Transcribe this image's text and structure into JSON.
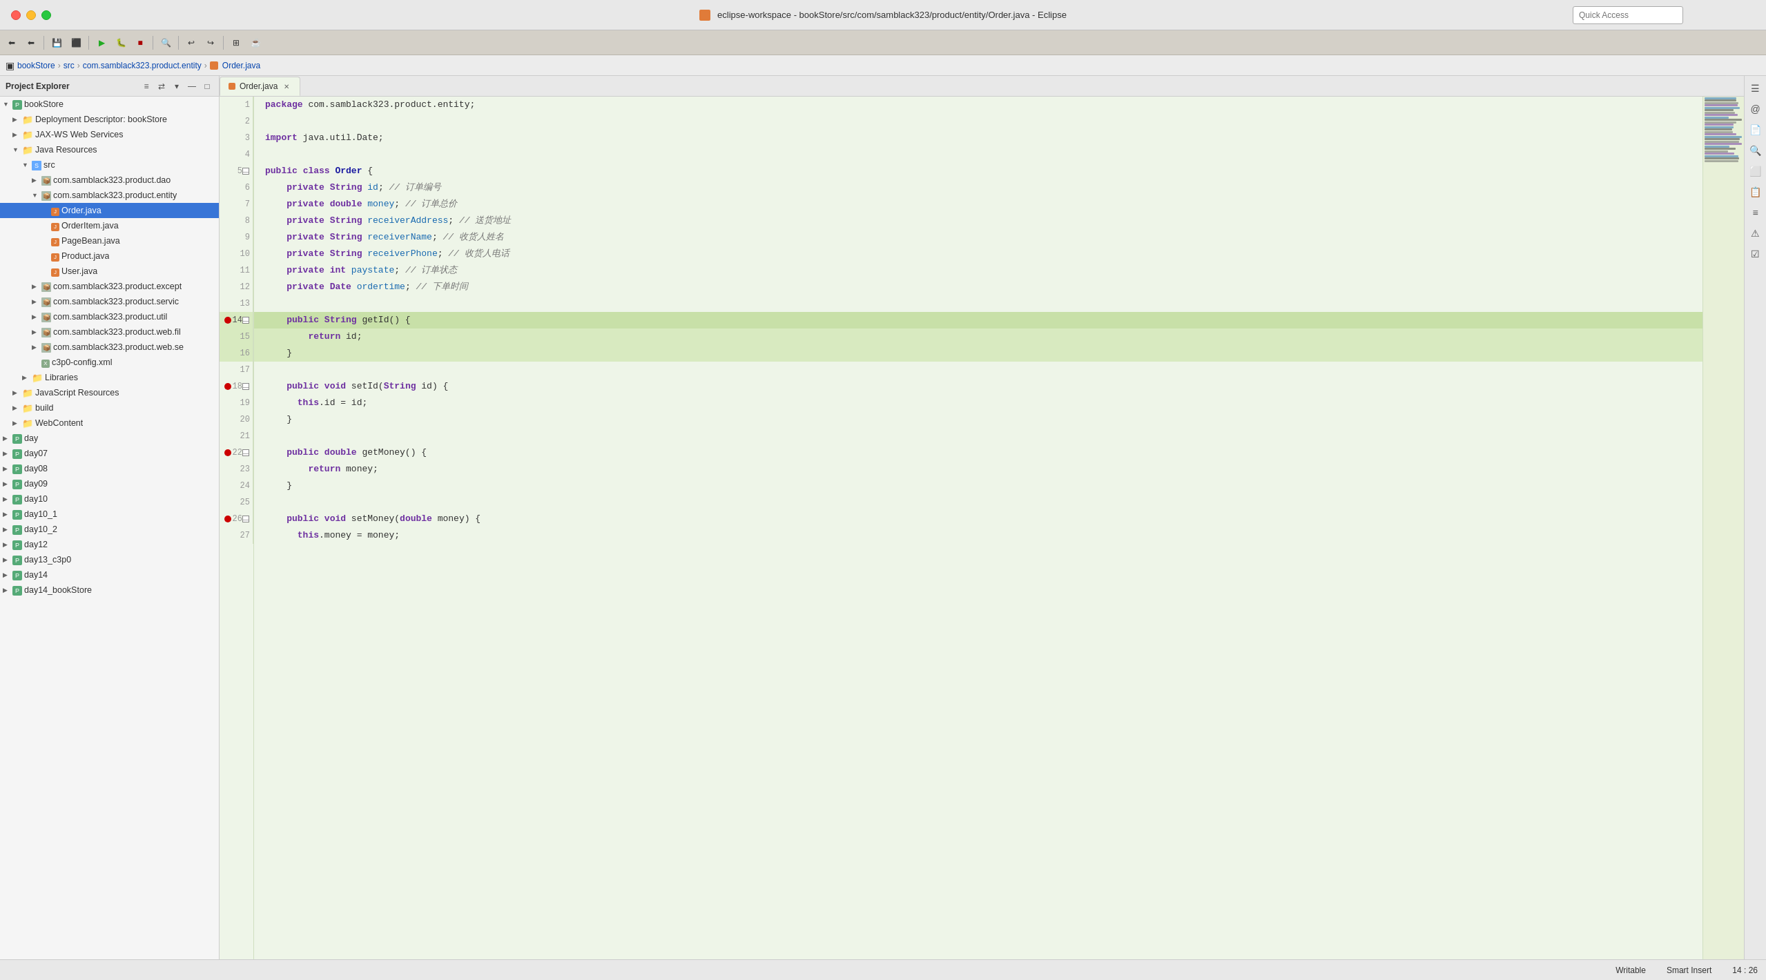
{
  "window": {
    "title": "eclipse-workspace - bookStore/src/com/samblack323/product/entity/Order.java - Eclipse",
    "quick_access_placeholder": "Quick Access"
  },
  "breadcrumb": {
    "items": [
      "bookStore",
      "src",
      "com.samblack323.product.entity",
      "Order.java"
    ]
  },
  "sidebar": {
    "title": "Project Explorer",
    "tree": [
      {
        "id": "bookStore",
        "label": "bookStore",
        "level": 0,
        "type": "project",
        "open": true
      },
      {
        "id": "deployment",
        "label": "Deployment Descriptor: bookStore",
        "level": 1,
        "type": "folder",
        "open": false
      },
      {
        "id": "jaxws",
        "label": "JAX-WS Web Services",
        "level": 1,
        "type": "folder",
        "open": false
      },
      {
        "id": "java-resources",
        "label": "Java Resources",
        "level": 1,
        "type": "folder",
        "open": true
      },
      {
        "id": "src",
        "label": "src",
        "level": 2,
        "type": "src-folder",
        "open": true
      },
      {
        "id": "pkg-dao",
        "label": "com.samblack323.product.dao",
        "level": 3,
        "type": "package",
        "open": false
      },
      {
        "id": "pkg-entity",
        "label": "com.samblack323.product.entity",
        "level": 3,
        "type": "package",
        "open": true
      },
      {
        "id": "Order.java",
        "label": "Order.java",
        "level": 4,
        "type": "java",
        "selected": true
      },
      {
        "id": "OrderItem.java",
        "label": "OrderItem.java",
        "level": 4,
        "type": "java"
      },
      {
        "id": "PageBean.java",
        "label": "PageBean.java",
        "level": 4,
        "type": "java"
      },
      {
        "id": "Product.java",
        "label": "Product.java",
        "level": 4,
        "type": "java"
      },
      {
        "id": "User.java",
        "label": "User.java",
        "level": 4,
        "type": "java"
      },
      {
        "id": "pkg-except",
        "label": "com.samblack323.product.except",
        "level": 3,
        "type": "package",
        "open": false
      },
      {
        "id": "pkg-service",
        "label": "com.samblack323.product.servic",
        "level": 3,
        "type": "package",
        "open": false
      },
      {
        "id": "pkg-util",
        "label": "com.samblack323.product.util",
        "level": 3,
        "type": "package",
        "open": false
      },
      {
        "id": "pkg-web-fil",
        "label": "com.samblack323.product.web.fil",
        "level": 3,
        "type": "package",
        "open": false
      },
      {
        "id": "pkg-web-se",
        "label": "com.samblack323.product.web.se",
        "level": 3,
        "type": "package",
        "open": false
      },
      {
        "id": "c3p0-config",
        "label": "c3p0-config.xml",
        "level": 3,
        "type": "xml"
      },
      {
        "id": "libraries",
        "label": "Libraries",
        "level": 2,
        "type": "folder",
        "open": false
      },
      {
        "id": "js-resources",
        "label": "JavaScript Resources",
        "level": 1,
        "type": "folder",
        "open": false
      },
      {
        "id": "build",
        "label": "build",
        "level": 1,
        "type": "folder",
        "open": false
      },
      {
        "id": "WebContent",
        "label": "WebContent",
        "level": 1,
        "type": "folder",
        "open": false
      },
      {
        "id": "day",
        "label": "day",
        "level": 0,
        "type": "project"
      },
      {
        "id": "day07",
        "label": "day07",
        "level": 0,
        "type": "project"
      },
      {
        "id": "day08",
        "label": "day08",
        "level": 0,
        "type": "project"
      },
      {
        "id": "day09",
        "label": "day09",
        "level": 0,
        "type": "project"
      },
      {
        "id": "day10",
        "label": "day10",
        "level": 0,
        "type": "project"
      },
      {
        "id": "day10_1",
        "label": "day10_1",
        "level": 0,
        "type": "project"
      },
      {
        "id": "day10_2",
        "label": "day10_2",
        "level": 0,
        "type": "project"
      },
      {
        "id": "day12",
        "label": "day12",
        "level": 0,
        "type": "project"
      },
      {
        "id": "day13_c3p0",
        "label": "day13_c3p0",
        "level": 0,
        "type": "project"
      },
      {
        "id": "day14",
        "label": "day14",
        "level": 0,
        "type": "project"
      },
      {
        "id": "day14_bookStore",
        "label": "day14_bookStore",
        "level": 0,
        "type": "project"
      }
    ]
  },
  "editor": {
    "tab": "Order.java",
    "lines": [
      {
        "num": 1,
        "tokens": [
          {
            "t": "package",
            "c": "kw"
          },
          {
            "t": " com.samblack323.product.entity;",
            "c": ""
          }
        ]
      },
      {
        "num": 2,
        "tokens": []
      },
      {
        "num": 3,
        "tokens": [
          {
            "t": "import",
            "c": "kw"
          },
          {
            "t": " java.util.Date;",
            "c": ""
          }
        ]
      },
      {
        "num": 4,
        "tokens": []
      },
      {
        "num": 5,
        "tokens": [
          {
            "t": "public",
            "c": "kw"
          },
          {
            "t": " ",
            "c": ""
          },
          {
            "t": "class",
            "c": "kw"
          },
          {
            "t": " ",
            "c": ""
          },
          {
            "t": "Order",
            "c": "cls"
          },
          {
            "t": " {",
            "c": ""
          }
        ]
      },
      {
        "num": 6,
        "tokens": [
          {
            "t": "    ",
            "c": ""
          },
          {
            "t": "private",
            "c": "kw"
          },
          {
            "t": " ",
            "c": ""
          },
          {
            "t": "String",
            "c": "type"
          },
          {
            "t": " ",
            "c": ""
          },
          {
            "t": "id",
            "c": "field"
          },
          {
            "t": "; ",
            "c": ""
          },
          {
            "t": "// 订单编号",
            "c": "comment"
          }
        ]
      },
      {
        "num": 7,
        "tokens": [
          {
            "t": "    ",
            "c": ""
          },
          {
            "t": "private",
            "c": "kw"
          },
          {
            "t": " ",
            "c": ""
          },
          {
            "t": "double",
            "c": "type"
          },
          {
            "t": " ",
            "c": ""
          },
          {
            "t": "money",
            "c": "field"
          },
          {
            "t": "; ",
            "c": ""
          },
          {
            "t": "// 订单总价",
            "c": "comment"
          }
        ]
      },
      {
        "num": 8,
        "tokens": [
          {
            "t": "    ",
            "c": ""
          },
          {
            "t": "private",
            "c": "kw"
          },
          {
            "t": " ",
            "c": ""
          },
          {
            "t": "String",
            "c": "type"
          },
          {
            "t": " ",
            "c": ""
          },
          {
            "t": "receiverAddress",
            "c": "field"
          },
          {
            "t": "; ",
            "c": ""
          },
          {
            "t": "// 送货地址",
            "c": "comment"
          }
        ]
      },
      {
        "num": 9,
        "tokens": [
          {
            "t": "    ",
            "c": ""
          },
          {
            "t": "private",
            "c": "kw"
          },
          {
            "t": " ",
            "c": ""
          },
          {
            "t": "String",
            "c": "type"
          },
          {
            "t": " ",
            "c": ""
          },
          {
            "t": "receiverName",
            "c": "field"
          },
          {
            "t": "; ",
            "c": ""
          },
          {
            "t": "// 收货人姓名",
            "c": "comment"
          }
        ]
      },
      {
        "num": 10,
        "tokens": [
          {
            "t": "    ",
            "c": ""
          },
          {
            "t": "private",
            "c": "kw"
          },
          {
            "t": " ",
            "c": ""
          },
          {
            "t": "String",
            "c": "type"
          },
          {
            "t": " ",
            "c": ""
          },
          {
            "t": "receiverPhone",
            "c": "field"
          },
          {
            "t": "; ",
            "c": ""
          },
          {
            "t": "// 收货人电话",
            "c": "comment"
          }
        ]
      },
      {
        "num": 11,
        "tokens": [
          {
            "t": "    ",
            "c": ""
          },
          {
            "t": "private",
            "c": "kw"
          },
          {
            "t": " ",
            "c": ""
          },
          {
            "t": "int",
            "c": "type"
          },
          {
            "t": " ",
            "c": ""
          },
          {
            "t": "paystate",
            "c": "field"
          },
          {
            "t": "; ",
            "c": ""
          },
          {
            "t": "// 订单状态",
            "c": "comment"
          }
        ]
      },
      {
        "num": 12,
        "tokens": [
          {
            "t": "    ",
            "c": ""
          },
          {
            "t": "private",
            "c": "kw"
          },
          {
            "t": " ",
            "c": ""
          },
          {
            "t": "Date",
            "c": "type"
          },
          {
            "t": " ",
            "c": ""
          },
          {
            "t": "ordertime",
            "c": "field"
          },
          {
            "t": "; ",
            "c": ""
          },
          {
            "t": "// 下单时间",
            "c": "comment"
          }
        ]
      },
      {
        "num": 13,
        "tokens": []
      },
      {
        "num": 14,
        "tokens": [
          {
            "t": "    ",
            "c": ""
          },
          {
            "t": "public",
            "c": "kw"
          },
          {
            "t": " ",
            "c": ""
          },
          {
            "t": "String",
            "c": "type"
          },
          {
            "t": " getId() {",
            "c": ""
          }
        ],
        "highlighted": true,
        "breakpoint": true
      },
      {
        "num": 15,
        "tokens": [
          {
            "t": "        ",
            "c": ""
          },
          {
            "t": "return",
            "c": "kw"
          },
          {
            "t": " id;",
            "c": ""
          }
        ],
        "highlighted": true
      },
      {
        "num": 16,
        "tokens": [
          {
            "t": "    }",
            "c": ""
          }
        ],
        "highlighted": true
      },
      {
        "num": 17,
        "tokens": []
      },
      {
        "num": 18,
        "tokens": [
          {
            "t": "    ",
            "c": ""
          },
          {
            "t": "public",
            "c": "kw"
          },
          {
            "t": " ",
            "c": ""
          },
          {
            "t": "void",
            "c": "type"
          },
          {
            "t": " setId(",
            "c": ""
          },
          {
            "t": "String",
            "c": "type"
          },
          {
            "t": " id) {",
            "c": ""
          }
        ],
        "breakpoint": true
      },
      {
        "num": 19,
        "tokens": [
          {
            "t": "      ",
            "c": ""
          },
          {
            "t": "this",
            "c": "kw"
          },
          {
            "t": ".id = id;",
            "c": ""
          }
        ]
      },
      {
        "num": 20,
        "tokens": [
          {
            "t": "    }",
            "c": ""
          }
        ]
      },
      {
        "num": 21,
        "tokens": []
      },
      {
        "num": 22,
        "tokens": [
          {
            "t": "    ",
            "c": ""
          },
          {
            "t": "public",
            "c": "kw"
          },
          {
            "t": " ",
            "c": ""
          },
          {
            "t": "double",
            "c": "type"
          },
          {
            "t": " getMoney() {",
            "c": ""
          }
        ],
        "breakpoint": true
      },
      {
        "num": 23,
        "tokens": [
          {
            "t": "        ",
            "c": ""
          },
          {
            "t": "return",
            "c": "kw"
          },
          {
            "t": " money;",
            "c": ""
          }
        ]
      },
      {
        "num": 24,
        "tokens": [
          {
            "t": "    }",
            "c": ""
          }
        ]
      },
      {
        "num": 25,
        "tokens": []
      },
      {
        "num": 26,
        "tokens": [
          {
            "t": "    ",
            "c": ""
          },
          {
            "t": "public",
            "c": "kw"
          },
          {
            "t": " ",
            "c": ""
          },
          {
            "t": "void",
            "c": "type"
          },
          {
            "t": " setMoney(",
            "c": ""
          },
          {
            "t": "double",
            "c": "type"
          },
          {
            "t": " money) {",
            "c": ""
          }
        ],
        "breakpoint": true
      },
      {
        "num": 27,
        "tokens": [
          {
            "t": "      ",
            "c": ""
          },
          {
            "t": "this",
            "c": "kw"
          },
          {
            "t": ".money = money;",
            "c": ""
          }
        ]
      }
    ]
  },
  "status_bar": {
    "writable": "Writable",
    "insert_mode": "Smart Insert",
    "position": "14 : 26"
  }
}
